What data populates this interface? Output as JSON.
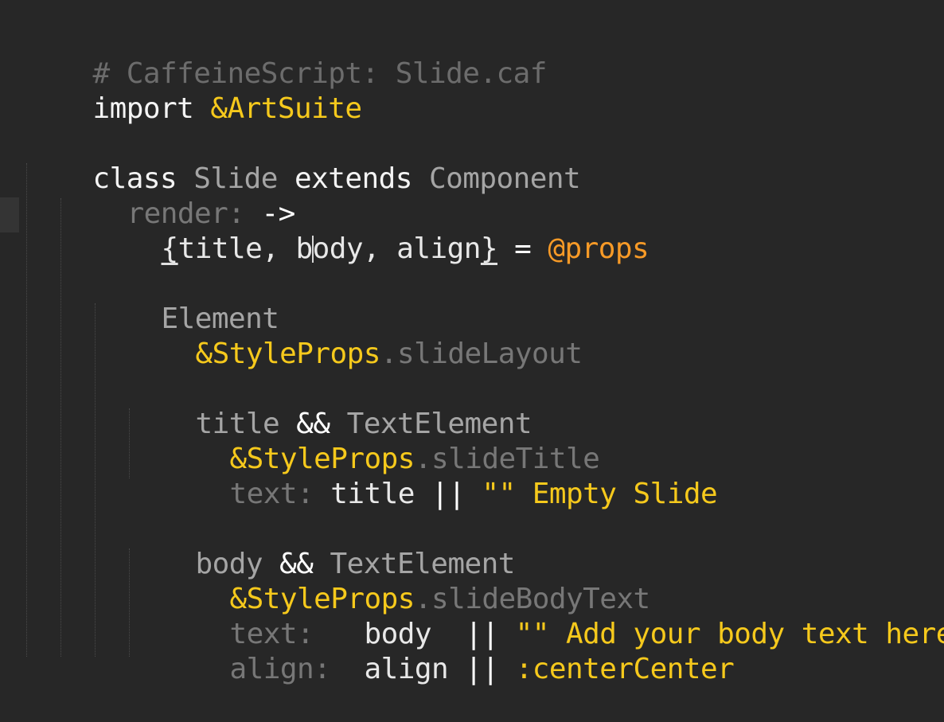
{
  "colors": {
    "background": "#272727",
    "comment": "#6c6c6c",
    "keyword": "#f4f4f4",
    "string_yellow": "#f6c91c",
    "this_ref_orange": "#f79a27",
    "identifier_gray": "#a5a5a5",
    "property_dim": "#777777"
  },
  "code": {
    "line_comment": "# CaffeineScript: Slide.caf",
    "line_import": {
      "keyword": "import",
      "module": "&ArtSuite"
    },
    "line_class": {
      "kw_class": "class",
      "name": "Slide",
      "kw_extends": "extends",
      "base": "Component"
    },
    "line_render": {
      "key": "render:",
      "arrow": "->"
    },
    "line_destructure": {
      "brace_open": "{",
      "part1": "title, b",
      "part2": "ody, align",
      "brace_close": "}",
      "equals": "=",
      "props": "@props"
    },
    "line_element": "Element",
    "line_slide_layout": {
      "ref": "&StyleProps",
      "prop": ".slideLayout"
    },
    "line_title_cond": {
      "ident": "title",
      "op": "&&",
      "type": "TextElement"
    },
    "line_slide_title": {
      "ref": "&StyleProps",
      "prop": ".slideTitle"
    },
    "line_title_text": {
      "key": "text:",
      "ident": "title",
      "op": "||",
      "string": "\"\" Empty Slide"
    },
    "line_body_cond": {
      "ident": "body",
      "op": "&&",
      "type": "TextElement"
    },
    "line_slide_body": {
      "ref": "&StyleProps",
      "prop": ".slideBodyText"
    },
    "line_body_text": {
      "key": "text:",
      "ident": "body",
      "op": "||",
      "string": "\"\" Add your body text here."
    },
    "line_body_align": {
      "key": "align:",
      "ident": "align",
      "op": "||",
      "string": ":centerCenter"
    }
  }
}
